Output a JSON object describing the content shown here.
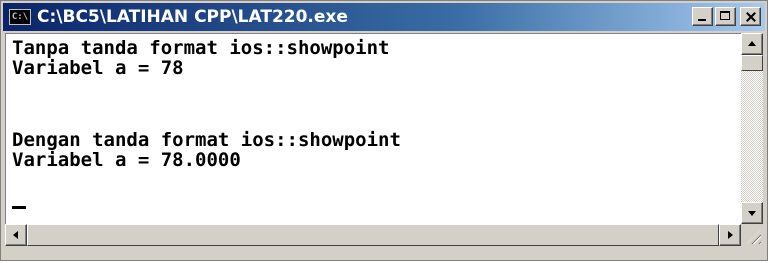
{
  "window": {
    "title": "C:\\BC5\\LATIHAN CPP\\LAT220.exe",
    "icon": "console-icon",
    "icon_text": "C:\\",
    "controls": [
      "minimize-icon",
      "maximize-icon",
      "close-icon"
    ]
  },
  "console": {
    "lines": [
      "Tanpa tanda format ios::showpoint",
      "Variabel a = 78",
      "",
      "Dengan tanda format ios::showpoint",
      "Variabel a = 78.0000"
    ]
  },
  "colors": {
    "title_bar_start": "#0a246a",
    "title_bar_end": "#a6caf0",
    "console_bg": "#ffffff",
    "console_text": "#000000",
    "chrome": "#d4d0c8"
  }
}
